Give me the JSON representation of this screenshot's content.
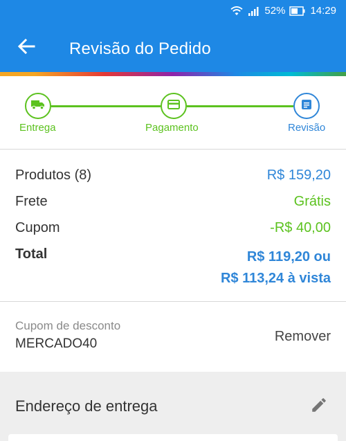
{
  "status_bar": {
    "battery": "52%",
    "time": "14:29"
  },
  "header": {
    "title": "Revisão do Pedido"
  },
  "steps": [
    {
      "label": "Entrega",
      "icon": "truck-icon",
      "state": "done"
    },
    {
      "label": "Pagamento",
      "icon": "credit-card-icon",
      "state": "done"
    },
    {
      "label": "Revisão",
      "icon": "document-icon",
      "state": "active"
    }
  ],
  "summary": {
    "products_label": "Produtos (8)",
    "products_value": "R$ 159,20",
    "shipping_label": "Frete",
    "shipping_value": "Grátis",
    "coupon_label": "Cupom",
    "coupon_value": "-R$ 40,00",
    "total_label": "Total",
    "total_value": "R$ 119,20 ou",
    "total_cash_value": "R$ 113,24 à vista"
  },
  "coupon": {
    "label": "Cupom de desconto",
    "code": "MERCADO40",
    "remove_label": "Remover"
  },
  "address": {
    "title": "Endereço de entrega"
  },
  "colors": {
    "primary": "#1e88e5",
    "step_done": "#5cc21f",
    "step_active": "#2f86d8",
    "price_blue": "#2f86d8",
    "green": "#5cc21f"
  }
}
